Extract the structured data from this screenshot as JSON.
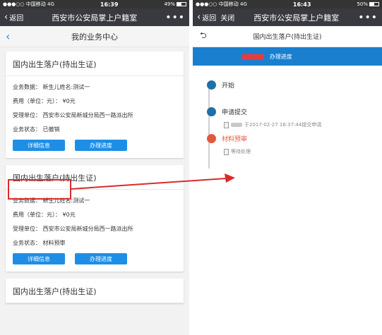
{
  "left": {
    "status": {
      "carrier": "●●●○○ 中国移动  4G",
      "time": "16:39",
      "battery_text": "49%",
      "battery_level": 0.49
    },
    "nav": {
      "back": "返回",
      "title": "西安市公安局掌上户籍室",
      "more": "•••"
    },
    "page_title": "我的业务中心",
    "cards": [
      {
        "title": "国内出生落户(持出生证)",
        "data": "业务数据：  新生儿姓名:测试一",
        "fee": "费用（单位：元）：  ¥0元",
        "office": "受理单位：  西安市公安局新城分局西一路派出所",
        "status": "业务状态：  已撤销",
        "btn_detail": "详细信息",
        "btn_progress": "办理进度"
      },
      {
        "title": "国内出生落户(持出生证)",
        "data": "业务数据：  新生儿姓名:测试一",
        "fee": "费用（单位：元）：  ¥0元",
        "office": "受理单位：  西安市公安局新城分局西一路派出所",
        "status": "业务状态：  材料预审",
        "btn_detail": "详细信息",
        "btn_progress": "办理进度"
      },
      {
        "title": "国内出生落户(持出生证)"
      }
    ]
  },
  "right": {
    "status": {
      "carrier": "●●●○○ 中国移动  4G",
      "time": "16:43",
      "battery_text": "50%",
      "battery_level": 0.5
    },
    "nav": {
      "back": "返回",
      "close": "关闭",
      "title": "西安市公安局掌上户籍室",
      "more": "•••"
    },
    "page_title": "国内出生落户(持出生证)",
    "tab_progress": "办理进度",
    "timeline": {
      "start": "开始",
      "submit": "申请提交",
      "submit_note": "于2017-02-27 16:37:44提交申请",
      "review": "材料预审",
      "review_note": "等待处理"
    }
  },
  "colors": {
    "accent": "#1d8ee6",
    "navbar": "#393a3f",
    "annotation": "#d92b2b",
    "review": "#e4573d"
  }
}
